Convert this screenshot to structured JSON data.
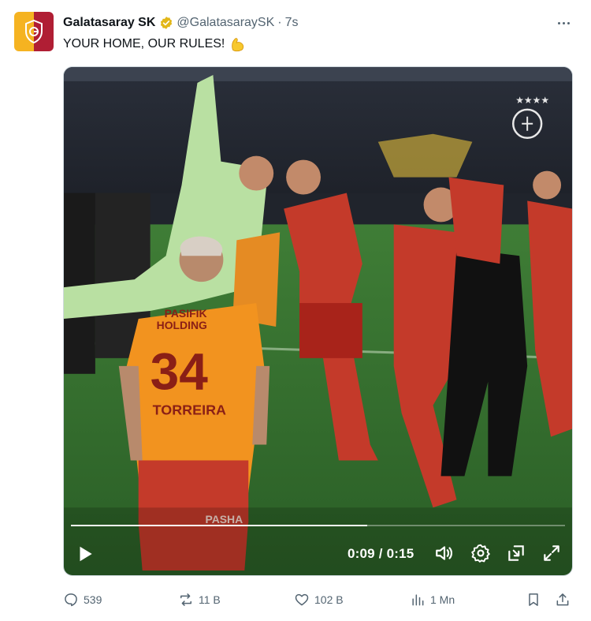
{
  "author": {
    "name": "Galatasaray SK",
    "handle": "@GalatasaraySK",
    "separator": "·",
    "time": "7s",
    "verified_icon": "gold-verified-badge"
  },
  "tweet": {
    "text": "YOUR HOME, OUR RULES!",
    "emoji": "flexed-biceps"
  },
  "video": {
    "current_time": "0:09",
    "duration": "0:15",
    "time_display": "0:09 / 0:15",
    "progress": 0.6,
    "jersey_number": "34",
    "jersey_sponsor_line1": "PASIFIK",
    "jersey_sponsor_line2": "HOLDING",
    "jersey_player_name": "TORREIRA",
    "shorts_sponsor": "PASHA",
    "controls": [
      "play-icon",
      "volume-icon",
      "settings-icon",
      "picture-in-picture-icon",
      "fullscreen-icon"
    ]
  },
  "actions": {
    "replies": "539",
    "reposts": "11 B",
    "likes": "102 B",
    "views": "1 Mn"
  },
  "colors": {
    "gold": "#f5b321",
    "red": "#b01e34",
    "text_secondary": "#536471",
    "pitch_green": "#2f6b2d"
  }
}
